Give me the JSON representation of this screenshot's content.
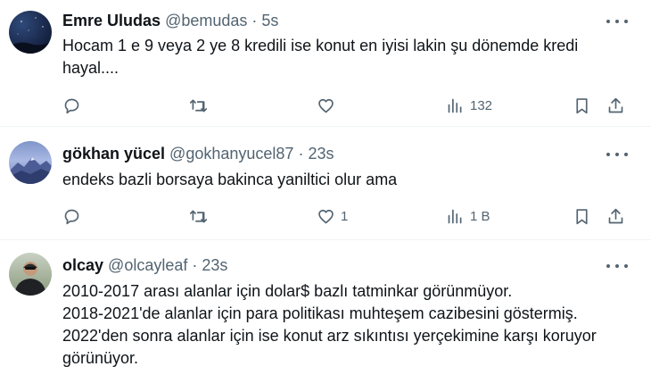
{
  "tweets": [
    {
      "name": "Emre Uludas",
      "handle": "@bemudas",
      "separator": "·",
      "time": "5s",
      "lines": [
        "Hocam 1 e 9 veya 2 ye 8 kredili ise konut en iyisi lakin şu dönemde kredi",
        "hayal...."
      ],
      "views": "132",
      "likes": "",
      "avatar": "night-sky"
    },
    {
      "name": "gökhan yücel",
      "handle": "@gokhanyucel87",
      "separator": "·",
      "time": "23s",
      "lines": [
        "endeks bazli borsaya bakinca yaniltici olur ama"
      ],
      "views": "1 B",
      "likes": "1",
      "avatar": "mountain"
    },
    {
      "name": "olcay",
      "handle": "@olcayleaf",
      "separator": "·",
      "time": "23s",
      "lines": [
        "2010-2017 arası alanlar için dolar$ bazlı tatminkar görünmüyor.",
        "2018-2021'de alanlar için para politikası muhteşem cazibesini göstermiş.",
        "2022'den sonra alanlar için ise konut arz sıkıntısı yerçekimine karşı koruyor",
        "görünüyor."
      ],
      "avatar": "person"
    }
  ],
  "icons": {
    "reply": "reply-icon",
    "retweet": "retweet-icon",
    "like": "like-icon",
    "views": "views-icon",
    "bookmark": "bookmark-icon",
    "share": "share-icon",
    "more": "more-icon"
  },
  "colors": {
    "text": "#0f1419",
    "secondary": "#536471",
    "divider": "#eff3f4"
  }
}
